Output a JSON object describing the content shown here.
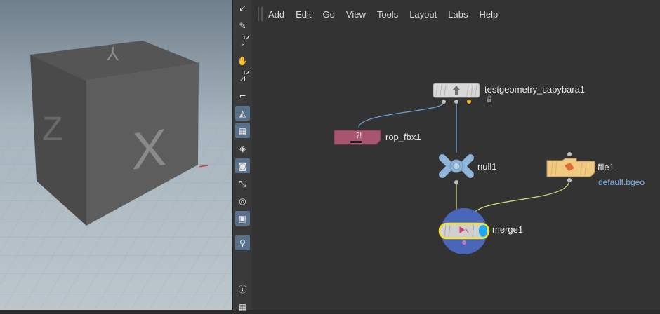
{
  "menu": [
    "Add",
    "Edit",
    "Go",
    "View",
    "Tools",
    "Layout",
    "Labs",
    "Help"
  ],
  "viewport": {
    "cube_labels": {
      "front": "X",
      "top": "Y",
      "side": "Z"
    }
  },
  "toolbar": {
    "tools": [
      {
        "icon": "select-arrow-icon",
        "glyph": "↙",
        "active": false
      },
      {
        "icon": "brush-icon",
        "glyph": "✎",
        "active": false
      },
      {
        "icon": "paint-12-icon",
        "glyph": "⸗",
        "badge": "12",
        "active": false
      },
      {
        "icon": "hand-icon",
        "glyph": "✋",
        "active": false
      },
      {
        "icon": "paint-bucket-12-icon",
        "glyph": "⊿",
        "badge": "12",
        "active": false
      },
      {
        "icon": "ruler-icon",
        "glyph": "⌐",
        "active": false
      },
      {
        "icon": "pose-icon",
        "glyph": "◭",
        "active": true
      },
      {
        "icon": "checker-icon",
        "glyph": "▦",
        "active": true
      },
      {
        "icon": "cube-icon",
        "glyph": "◈",
        "active": false
      },
      {
        "icon": "camera-icon",
        "glyph": "◙",
        "active": true
      },
      {
        "icon": "transform-icon",
        "glyph": "⤡",
        "active": false
      },
      {
        "icon": "display-icon",
        "glyph": "◎",
        "active": false
      },
      {
        "icon": "image-icon",
        "glyph": "▣",
        "active": true
      },
      {
        "icon": "pin-icon",
        "glyph": "⚲",
        "active": true
      },
      {
        "icon": "info-icon",
        "glyph": "ⓘ",
        "active": false
      },
      {
        "icon": "layout-grid-icon",
        "glyph": "▦",
        "active": false
      }
    ]
  },
  "nodes": {
    "testgeometry": {
      "label": "testgeometry_capybara1"
    },
    "rop_fbx": {
      "label": "rop_fbx1"
    },
    "null": {
      "label": "null1"
    },
    "file": {
      "label": "file1",
      "sub": "default.bgeo"
    },
    "merge": {
      "label": "merge1"
    }
  },
  "colors": {
    "rop": "#a8556f",
    "file": "#f0c982",
    "merge": "#4a66b8",
    "null": "#8fb5d8",
    "highlight": "#f2e22a",
    "wire_blue": "#6f9fcf",
    "wire_yellow": "#cfd27a"
  }
}
